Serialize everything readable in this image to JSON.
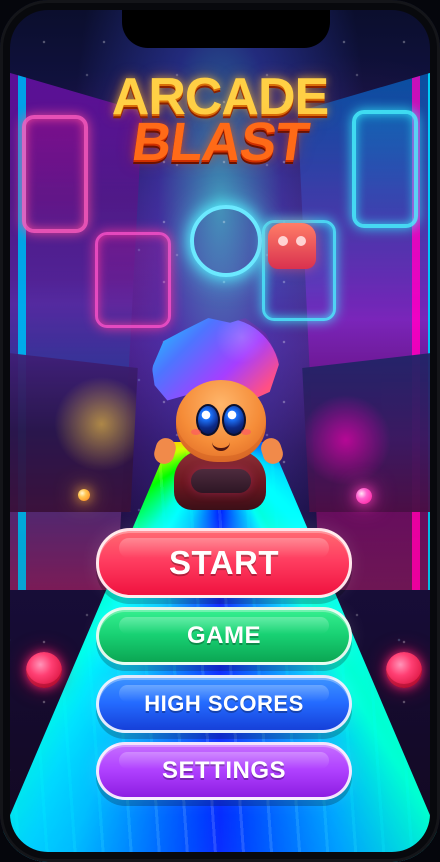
{
  "title": {
    "line1": "ARCADE",
    "line2": "BLAST"
  },
  "menu": {
    "start": "START",
    "game": "GAME",
    "high_scores": "HIGH SCORES",
    "settings": "SETTINGS"
  },
  "icons": {
    "left_orb": "left-orb-button-icon",
    "right_orb": "right-orb-button-icon",
    "mascot": "mascot-character-icon"
  },
  "colors": {
    "start": "#ff4a66",
    "game": "#1ed676",
    "high_scores": "#2a6fff",
    "settings": "#b243ff",
    "title_yellow": "#ffd045",
    "title_orange": "#ff6a17"
  }
}
